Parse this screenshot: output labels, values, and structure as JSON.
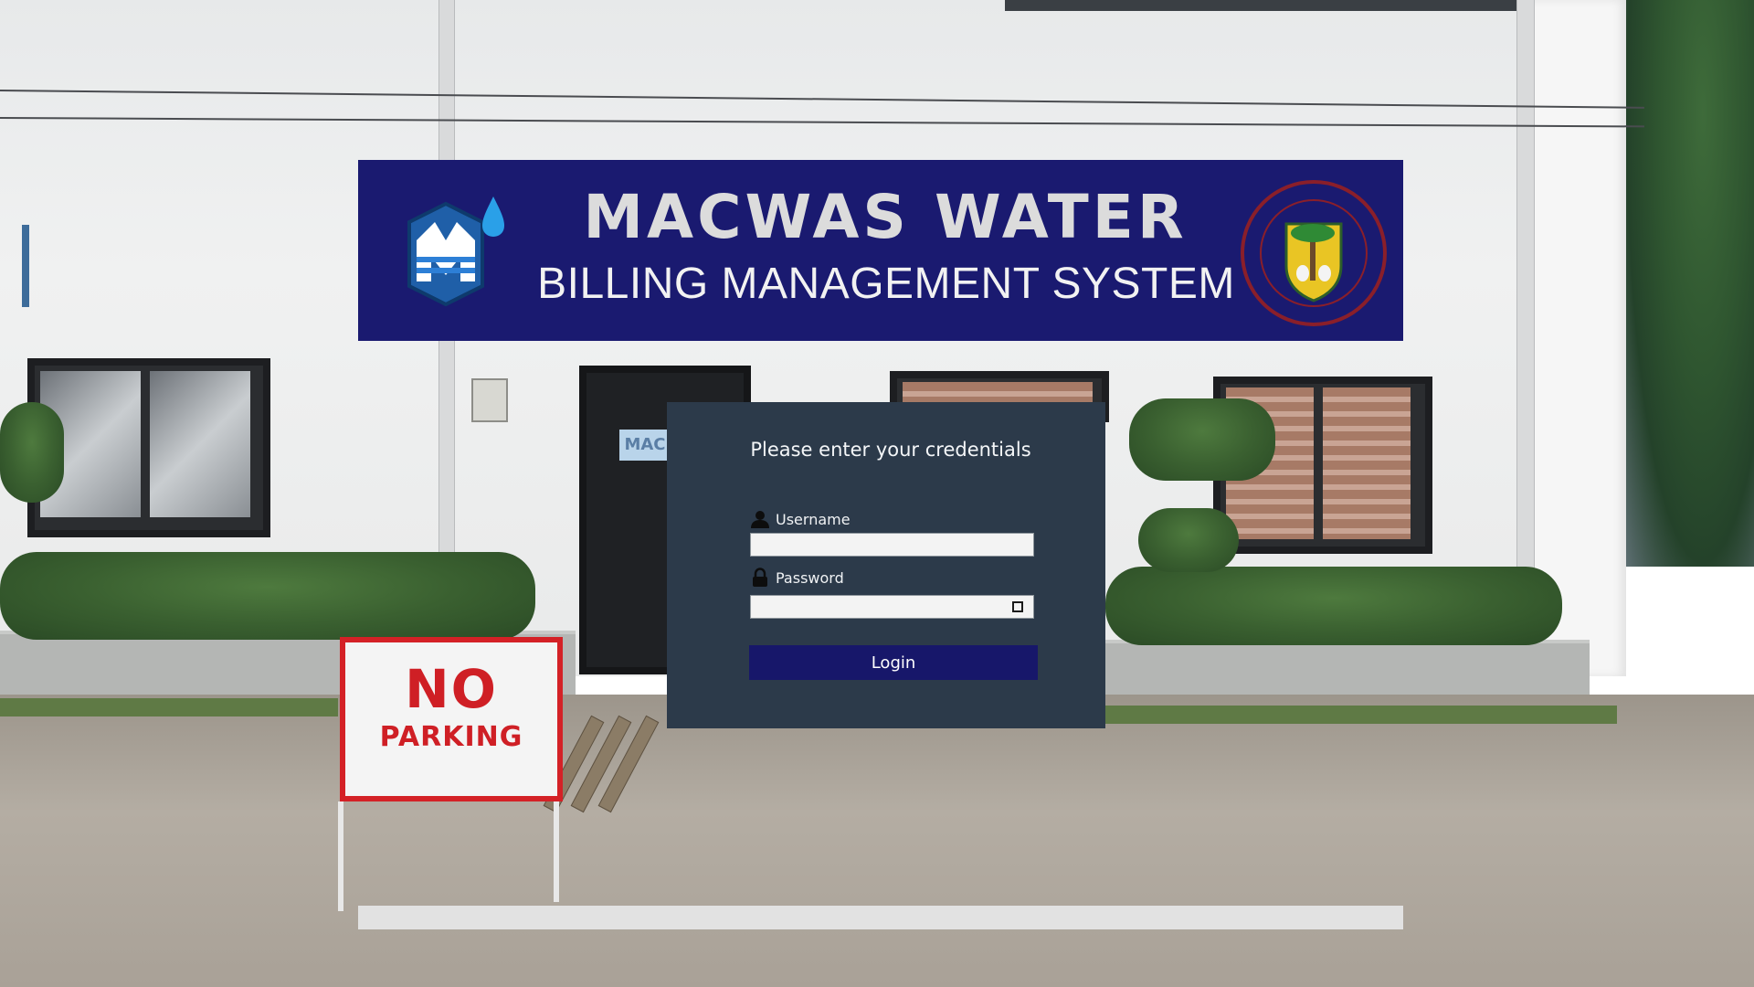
{
  "header": {
    "title": "MACWAS WATER",
    "subtitle": "BILLING MANAGEMENT SYSTEM",
    "logo_icon": "water-drop-logo",
    "seal_icon": "municipal-seal",
    "background_color": "#1a1a70"
  },
  "login": {
    "heading": "Please enter your credentials",
    "username_label": "Username",
    "username_value": "",
    "password_label": "Password",
    "password_value": "",
    "login_button": "Login",
    "user_icon": "user-icon",
    "lock_icon": "lock-icon",
    "panel_color": "#2c3a4a",
    "button_color": "#17176a"
  },
  "background": {
    "sign_line1": "NO",
    "sign_line2": "PARKING",
    "door_sticker": "MAC"
  }
}
